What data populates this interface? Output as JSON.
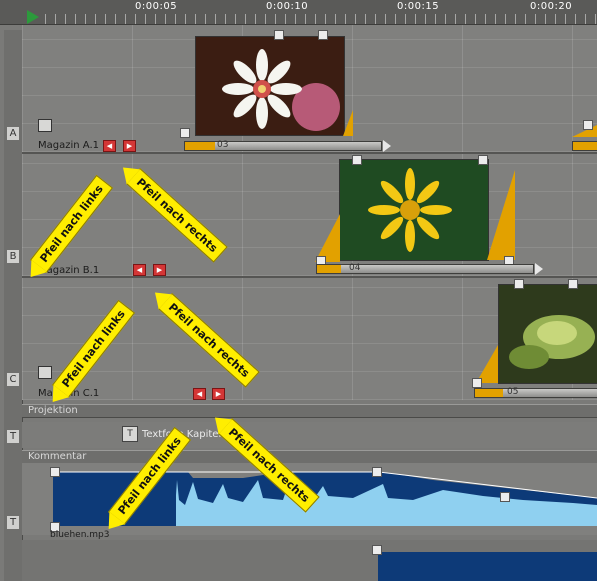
{
  "ruler": {
    "timecodes": [
      "0:00:05",
      "0:00:10",
      "0:00:15",
      "0:00:20"
    ]
  },
  "tracks": {
    "a": {
      "side_label": "A",
      "name": "Magazin A.1",
      "clip_label": "03"
    },
    "b": {
      "side_label": "B",
      "name": "Magazin B.1",
      "clip_label": "04"
    },
    "c": {
      "side_label": "C",
      "name": "Magazin C.1",
      "clip_label": "05"
    }
  },
  "sections": {
    "projection": "Projektion",
    "comment": "Kommentar"
  },
  "text_lane": {
    "side_label": "T",
    "label": "Textfolie Kapitel Nr."
  },
  "audio": {
    "side_label": "T",
    "file": "bluehen.mp3"
  },
  "callouts": {
    "left_a": "Pfeil nach links",
    "right_a": "Pfeil nach rechts",
    "left_b": "Pfeil nach links",
    "right_b": "Pfeil nach rechts",
    "left_c": "Pfeil nach links",
    "right_c": "Pfeil nach rechts"
  },
  "colors": {
    "accent_orange": "#e2a100",
    "audio_dark": "#0d3a78",
    "audio_light": "#8fd0f0",
    "callout_yellow": "#ffee00",
    "arrow_red": "#d43636"
  }
}
